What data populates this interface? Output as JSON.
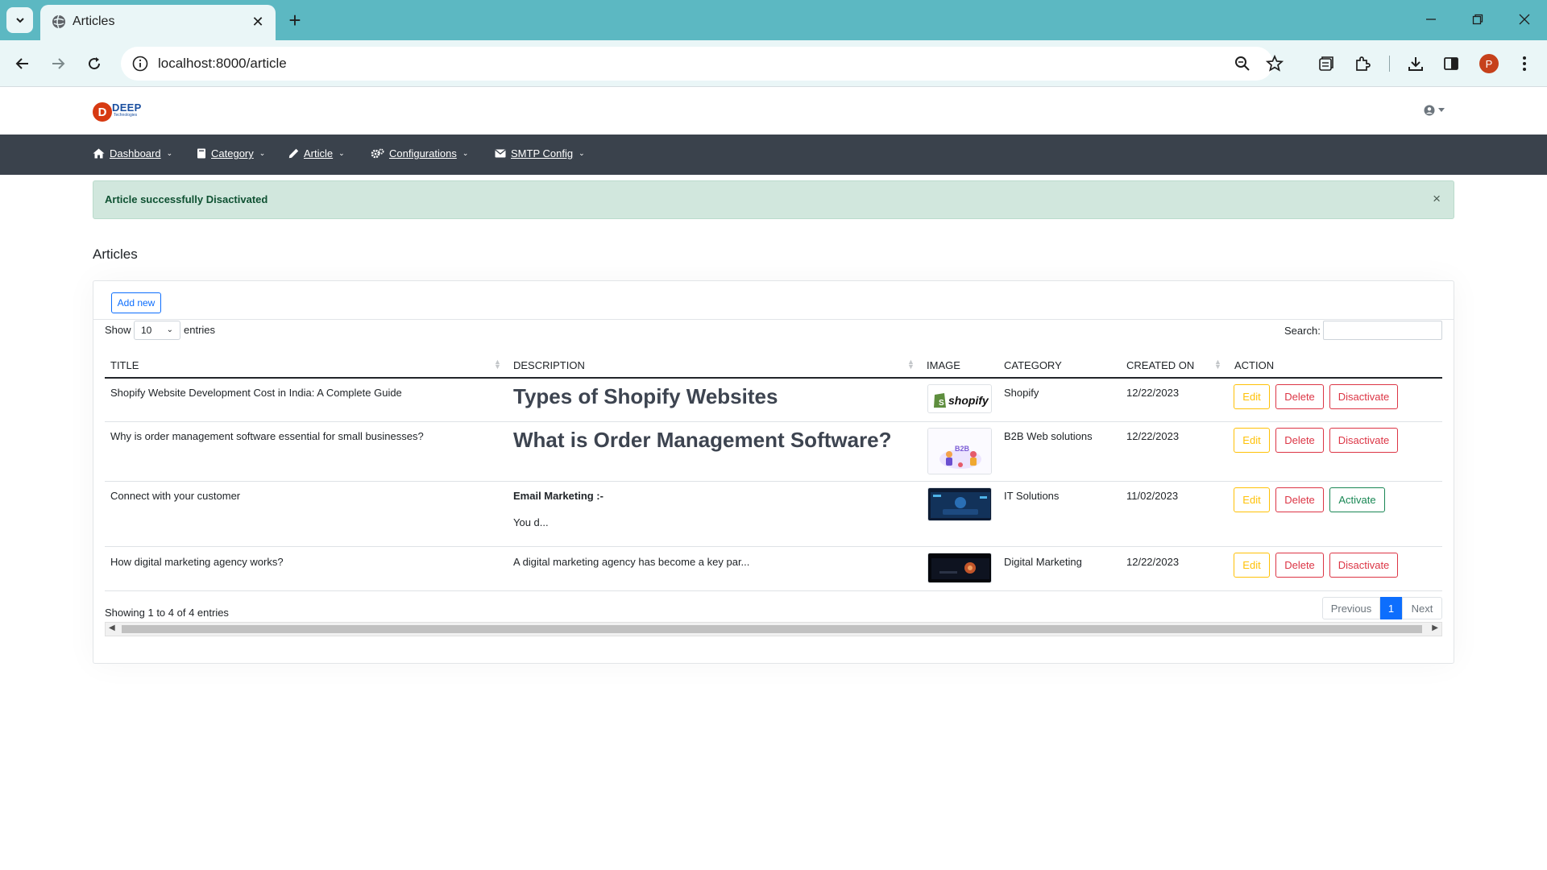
{
  "browser": {
    "tab_title": "Articles",
    "url": "localhost:8000/article",
    "profile_initial": "P"
  },
  "site": {
    "logo_letter": "D",
    "logo_text": "DEEP",
    "logo_sub": "Technologies"
  },
  "nav": {
    "dashboard": "Dashboard",
    "category": "Category",
    "article": "Article",
    "configurations": "Configurations",
    "smtp": "SMTP Config"
  },
  "alert": {
    "message": "Article successfully Disactivated",
    "close": "×"
  },
  "page": {
    "title": "Articles"
  },
  "controls": {
    "add_new": "Add new",
    "show_label": "Show",
    "entries_label": "entries",
    "length_value": "10",
    "search_label": "Search:"
  },
  "table": {
    "headers": [
      "TITLE",
      "DESCRIPTION",
      "IMAGE",
      "CATEGORY",
      "CREATED ON",
      "ACTION"
    ],
    "rows": [
      {
        "title": "Shopify Website Development Cost in India: A Complete Guide",
        "description": "Types of Shopify Websites",
        "image": "shopify",
        "category": "Shopify",
        "created_on": "12/22/2023",
        "edit": "Edit",
        "delete": "Delete",
        "toggle": "Disactivate"
      },
      {
        "title": "Why is order management software essential for small businesses?",
        "description": "What is Order Management Software?",
        "image": "B2B",
        "category": "B2B Web solutions",
        "created_on": "12/22/2023",
        "edit": "Edit",
        "delete": "Delete",
        "toggle": "Disactivate"
      },
      {
        "title": "Connect with your customer",
        "description": "Email Marketing :-",
        "description_extra": "You d...",
        "image": "it-solutions-photo",
        "category": "IT Solutions",
        "created_on": "11/02/2023",
        "edit": "Edit",
        "delete": "Delete",
        "toggle": "Activate"
      },
      {
        "title": "How digital marketing agency works?",
        "description": "A digital marketing agency has become a key par...",
        "image": "digital-marketing-photo",
        "category": "Digital Marketing",
        "created_on": "12/22/2023",
        "edit": "Edit",
        "delete": "Delete",
        "toggle": "Disactivate"
      }
    ]
  },
  "footer": {
    "info": "Showing 1 to 4 of 4 entries",
    "previous": "Previous",
    "page_1": "1",
    "next": "Next"
  },
  "colors": {
    "chrome_accent": "#5cb8c2",
    "nav_bg": "#3a424c",
    "alert_bg": "#d1e7dd",
    "primary": "#0d6efd",
    "warning": "#ffc107",
    "danger": "#dc3545",
    "success": "#198754"
  }
}
